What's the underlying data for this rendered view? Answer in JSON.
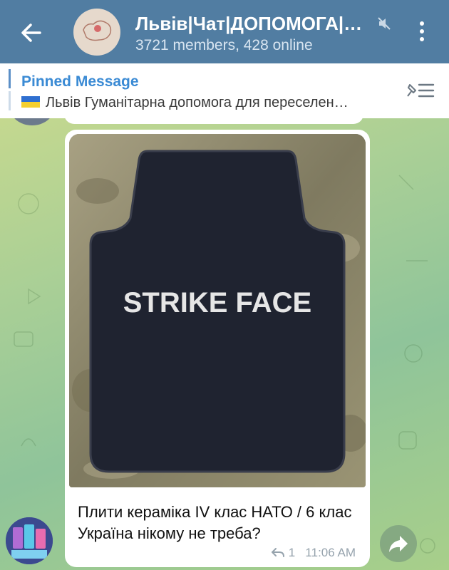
{
  "header": {
    "title": "Львів|Чат|ДОПОМОГА|…",
    "subtitle": "3721 members, 428 online"
  },
  "pinned": {
    "label": "Pinned Message",
    "text": "Львів  Гуманітарна допомога для переселен…"
  },
  "message": {
    "image_text": "STRIKE FACE",
    "caption": "Плити кераміка IV клас НАТО / 6 клас Україна нікому не треба?",
    "reply_count": "1",
    "time": "11:06 AM"
  },
  "colors": {
    "header_bg": "#517da2",
    "accent": "#3a8ad4",
    "chat_bg": "#a9cf96"
  },
  "icons": [
    "back-arrow-icon",
    "mute-icon",
    "more-vertical-icon",
    "pin-list-icon",
    "reply-icon",
    "share-icon",
    "ukraine-flag-icon"
  ]
}
